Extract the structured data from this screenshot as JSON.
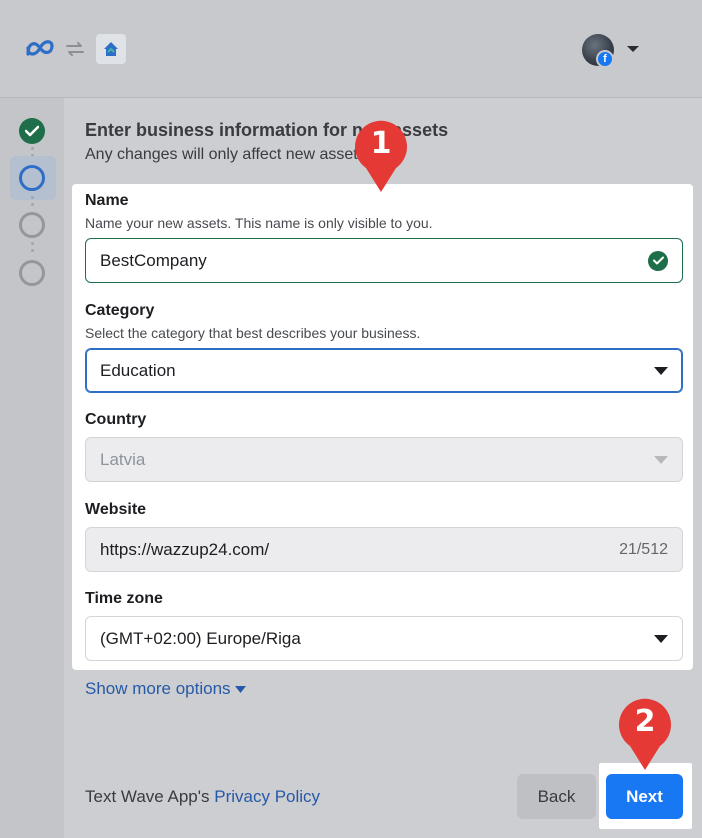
{
  "header": {
    "meta_logo_icon": "meta-logo-icon",
    "swap_icon": "swap-arrows-icon",
    "app_logo_icon": "app-house-icon",
    "avatar_badge": "f"
  },
  "stepper": {
    "steps": [
      "completed",
      "active",
      "pending",
      "pending"
    ]
  },
  "main": {
    "heading": "Enter business information for new assets",
    "subheading": "Any changes will only affect new assets"
  },
  "form": {
    "name": {
      "label": "Name",
      "hint": "Name your new assets. This name is only visible to you.",
      "value": "BestCompany"
    },
    "category": {
      "label": "Category",
      "hint": "Select the category that best describes your business.",
      "value": "Education"
    },
    "country": {
      "label": "Country",
      "value": "Latvia"
    },
    "website": {
      "label": "Website",
      "value": "https://wazzup24.com/",
      "counter": "21/512"
    },
    "timezone": {
      "label": "Time zone",
      "value": "(GMT+02:00) Europe/Riga"
    },
    "more_options": "Show more options"
  },
  "footer": {
    "policy_prefix": "Text Wave App's",
    "policy_link": "Privacy Policy",
    "back_label": "Back",
    "next_label": "Next"
  },
  "annotations": {
    "marker_1": "1",
    "marker_2": "2"
  },
  "colors": {
    "primary": "#1877f2",
    "success": "#1f6e4a",
    "link": "#2659a7",
    "marker": "#e53935"
  }
}
